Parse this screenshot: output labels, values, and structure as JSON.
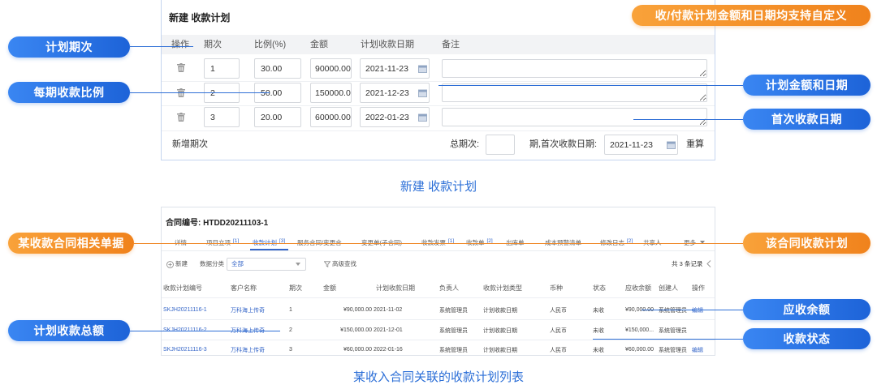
{
  "callouts": {
    "banner": "收/付款计划金额和日期均支持自定义",
    "plan_periods": "计划期次",
    "period_ratio": "每期收款比例",
    "amount_and_date": "计划金额和日期",
    "first_date": "首次收款日期",
    "related_docs": "某收款合同相关单据",
    "contract_plan": "该合同收款计划",
    "receivable_balance": "应收余额",
    "payment_status": "收款状态",
    "plan_total": "计划收款总额"
  },
  "captions": {
    "top": "新建 收款计划",
    "bottom": "某收入合同关联的收款计划列表"
  },
  "new_plan": {
    "title": "新建 收款计划",
    "headers": {
      "action": "操作",
      "period": "期次",
      "ratio": "比例(%)",
      "amount": "金额",
      "date": "计划收款日期",
      "note": "备注"
    },
    "rows": [
      {
        "period": "1",
        "ratio": "30.00",
        "amount": "90000.00",
        "date": "2021-11-23"
      },
      {
        "period": "2",
        "ratio": "50.00",
        "amount": "150000.0",
        "date": "2021-12-23"
      },
      {
        "period": "3",
        "ratio": "20.00",
        "amount": "60000.00",
        "date": "2022-01-23"
      }
    ],
    "add_period": "新增期次",
    "total_periods_label": "总期次:",
    "first_date_label": "期,首次收款日期:",
    "first_date_value": "2021-11-23",
    "recalc": "重算"
  },
  "contract": {
    "title": "合同编号: HTDD20211103-1",
    "tabs": [
      {
        "label": "详情"
      },
      {
        "label": "项目立项",
        "count": "[1]"
      },
      {
        "label": "收款计划",
        "count": "[3]",
        "active": true
      },
      {
        "label": "服务合同/变更合"
      },
      {
        "label": "变更单(子合同)"
      },
      {
        "label": "收款发票",
        "count": "[1]"
      },
      {
        "label": "收款单",
        "count": "[2]"
      },
      {
        "label": "出库单"
      },
      {
        "label": "成本预警清单"
      },
      {
        "label": "修改日志",
        "count": "[2]"
      },
      {
        "label": "共享人"
      },
      {
        "label": "更多"
      }
    ],
    "toolbar": {
      "new": "新建",
      "category_label": "数据分类",
      "category_value": "全部",
      "advanced_search": "高级查找",
      "record_count": "共 3 条记录"
    },
    "table": {
      "headers": [
        "收款计划编号",
        "客户名称",
        "期次",
        "金额",
        "计划收款日期",
        "负责人",
        "收款计划类型",
        "币种",
        "状态",
        "应收余额",
        "创建人",
        "操作"
      ],
      "rows": [
        {
          "code": "SKJH20211116-1",
          "customer": "万科海上传奇",
          "period": "1",
          "amount": "¥90,000.00",
          "date": "2021-11-02",
          "owner": "系统管理员",
          "type": "计划收款日期",
          "currency": "人民币",
          "status": "未收",
          "balance": "¥90,000.00",
          "creator": "系统管理员",
          "action": "编辑"
        },
        {
          "code": "SKJH20211116-2",
          "customer": "万科海上传奇",
          "period": "2",
          "amount": "¥150,000.00",
          "date": "2021-12-01",
          "owner": "系统管理员",
          "type": "计划收款日期",
          "currency": "人民币",
          "status": "未收",
          "balance": "¥150,000...",
          "creator": "系统管理员"
        },
        {
          "code": "SKJH20211116-3",
          "customer": "万科海上传奇",
          "period": "3",
          "amount": "¥60,000.00",
          "date": "2022-01-16",
          "owner": "系统管理员",
          "type": "计划收款日期",
          "currency": "人民币",
          "status": "未收",
          "balance": "¥60,000.00",
          "creator": "系统管理员",
          "action": "编辑"
        }
      ]
    }
  },
  "icons": {
    "delete": "trash-icon",
    "date_picker": "calendar-icon",
    "new": "plus-circle-icon",
    "filter": "filter-icon",
    "dropdown": "chevron-down-icon",
    "prev_page": "chevron-left-icon"
  },
  "colors": {
    "callout_blue": "#1d63d8",
    "callout_orange": "#f0821c",
    "link": "#3566c8",
    "caption": "#2c6fd7"
  }
}
